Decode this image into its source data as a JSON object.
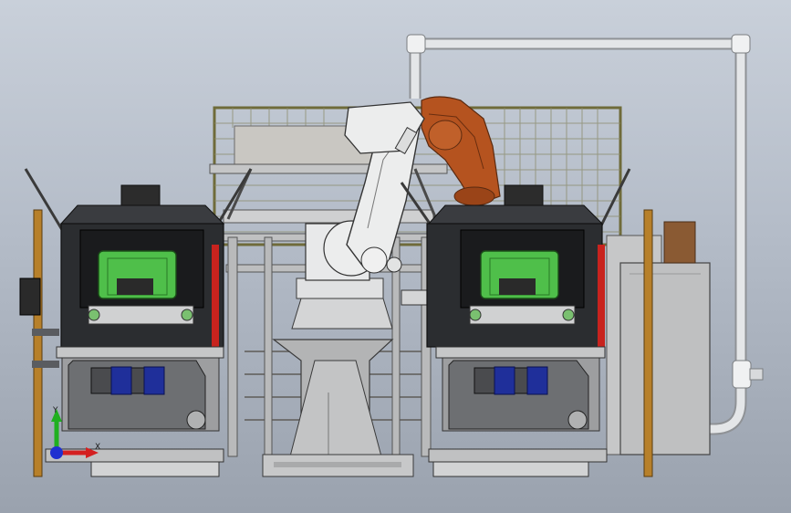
{
  "viewport": {
    "background_top": "#c9d0da",
    "background_bottom": "#9aa2ae"
  },
  "scene_colors": {
    "frame_grey": "#b7b9bb",
    "machine_dark": "#2b2d30",
    "panel_green": "#4fbf4a",
    "robot_white": "#e8e9ea",
    "robot_orange": "#b5531f",
    "motor_blue": "#1f2f9a",
    "pipe_white": "#e4e6e8",
    "post_orange": "#b7802a",
    "red_hose": "#c8231e",
    "cabinet_brown": "#8a5a33"
  },
  "triad": {
    "x_label": "X",
    "y_label": "Y",
    "x_color": "#d42020",
    "y_color": "#20b020",
    "z_color": "#2030d0"
  }
}
